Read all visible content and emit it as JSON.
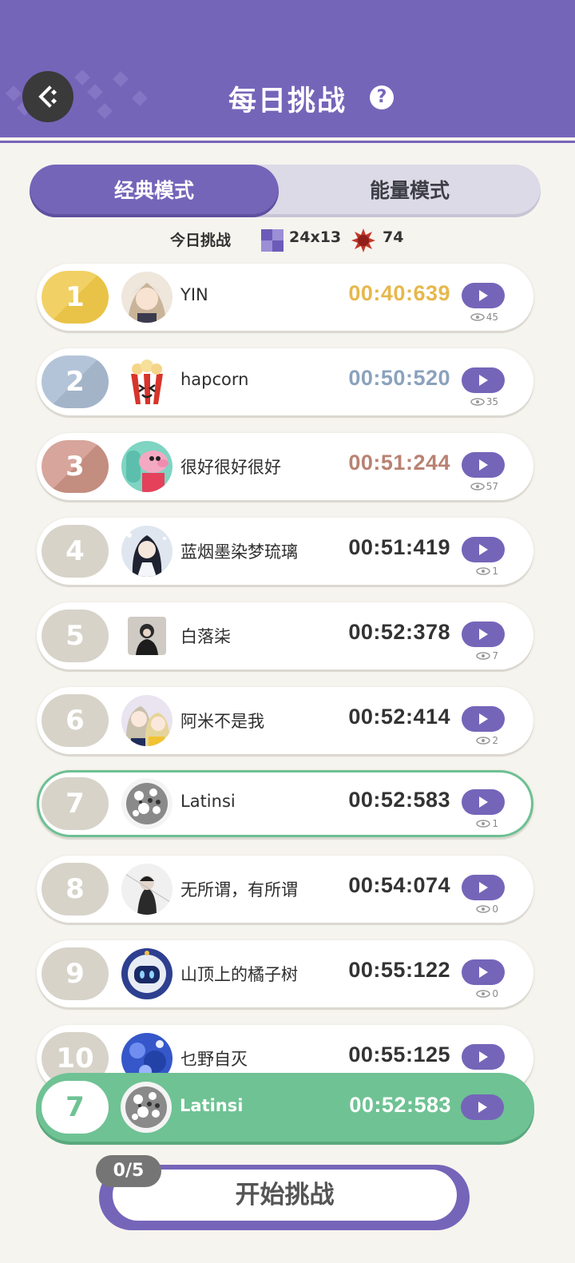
{
  "header": {
    "title": "每日挑战",
    "help_icon": "question-circle-icon",
    "back_icon": "back-arrow-icon",
    "background_color": "#7565b9"
  },
  "tabs": [
    {
      "label": "经典模式",
      "active": true
    },
    {
      "label": "能量模式",
      "active": false
    }
  ],
  "challenge_info": {
    "label": "今日挑战",
    "grid_size": "24x13",
    "mines": "74"
  },
  "leaderboard": [
    {
      "rank": "1",
      "name": "YIN",
      "time": "00:40:639",
      "views": "45",
      "tier": "gold"
    },
    {
      "rank": "2",
      "name": "hapcorn",
      "time": "00:50:520",
      "views": "35",
      "tier": "silver"
    },
    {
      "rank": "3",
      "name": "很好很好很好",
      "time": "00:51:244",
      "views": "57",
      "tier": "bronze"
    },
    {
      "rank": "4",
      "name": "蓝烟墨染梦琉璃",
      "time": "00:51:419",
      "views": "1",
      "tier": "normal"
    },
    {
      "rank": "5",
      "name": "白落柒",
      "time": "00:52:378",
      "views": "7",
      "tier": "normal"
    },
    {
      "rank": "6",
      "name": "阿米不是我",
      "time": "00:52:414",
      "views": "2",
      "tier": "normal"
    },
    {
      "rank": "7",
      "name": "Latinsi",
      "time": "00:52:583",
      "views": "1",
      "tier": "normal",
      "is_me": true
    },
    {
      "rank": "8",
      "name": "无所谓，有所谓",
      "time": "00:54:074",
      "views": "0",
      "tier": "normal"
    },
    {
      "rank": "9",
      "name": "山顶上的橘子树",
      "time": "00:55:122",
      "views": "0",
      "tier": "normal"
    },
    {
      "rank": "10",
      "name": "乜野自灭",
      "time": "00:55:125",
      "views": "",
      "tier": "normal"
    }
  ],
  "my_entry": {
    "rank": "7",
    "name": "Latinsi",
    "time": "00:52:583"
  },
  "start": {
    "label": "开始挑战",
    "attempts": "0/5"
  },
  "colors": {
    "accent": "#7565b9",
    "me_green": "#6fc294",
    "gold": "#e6b84c",
    "silver": "#8ba2bd",
    "bronze": "#b98273"
  }
}
